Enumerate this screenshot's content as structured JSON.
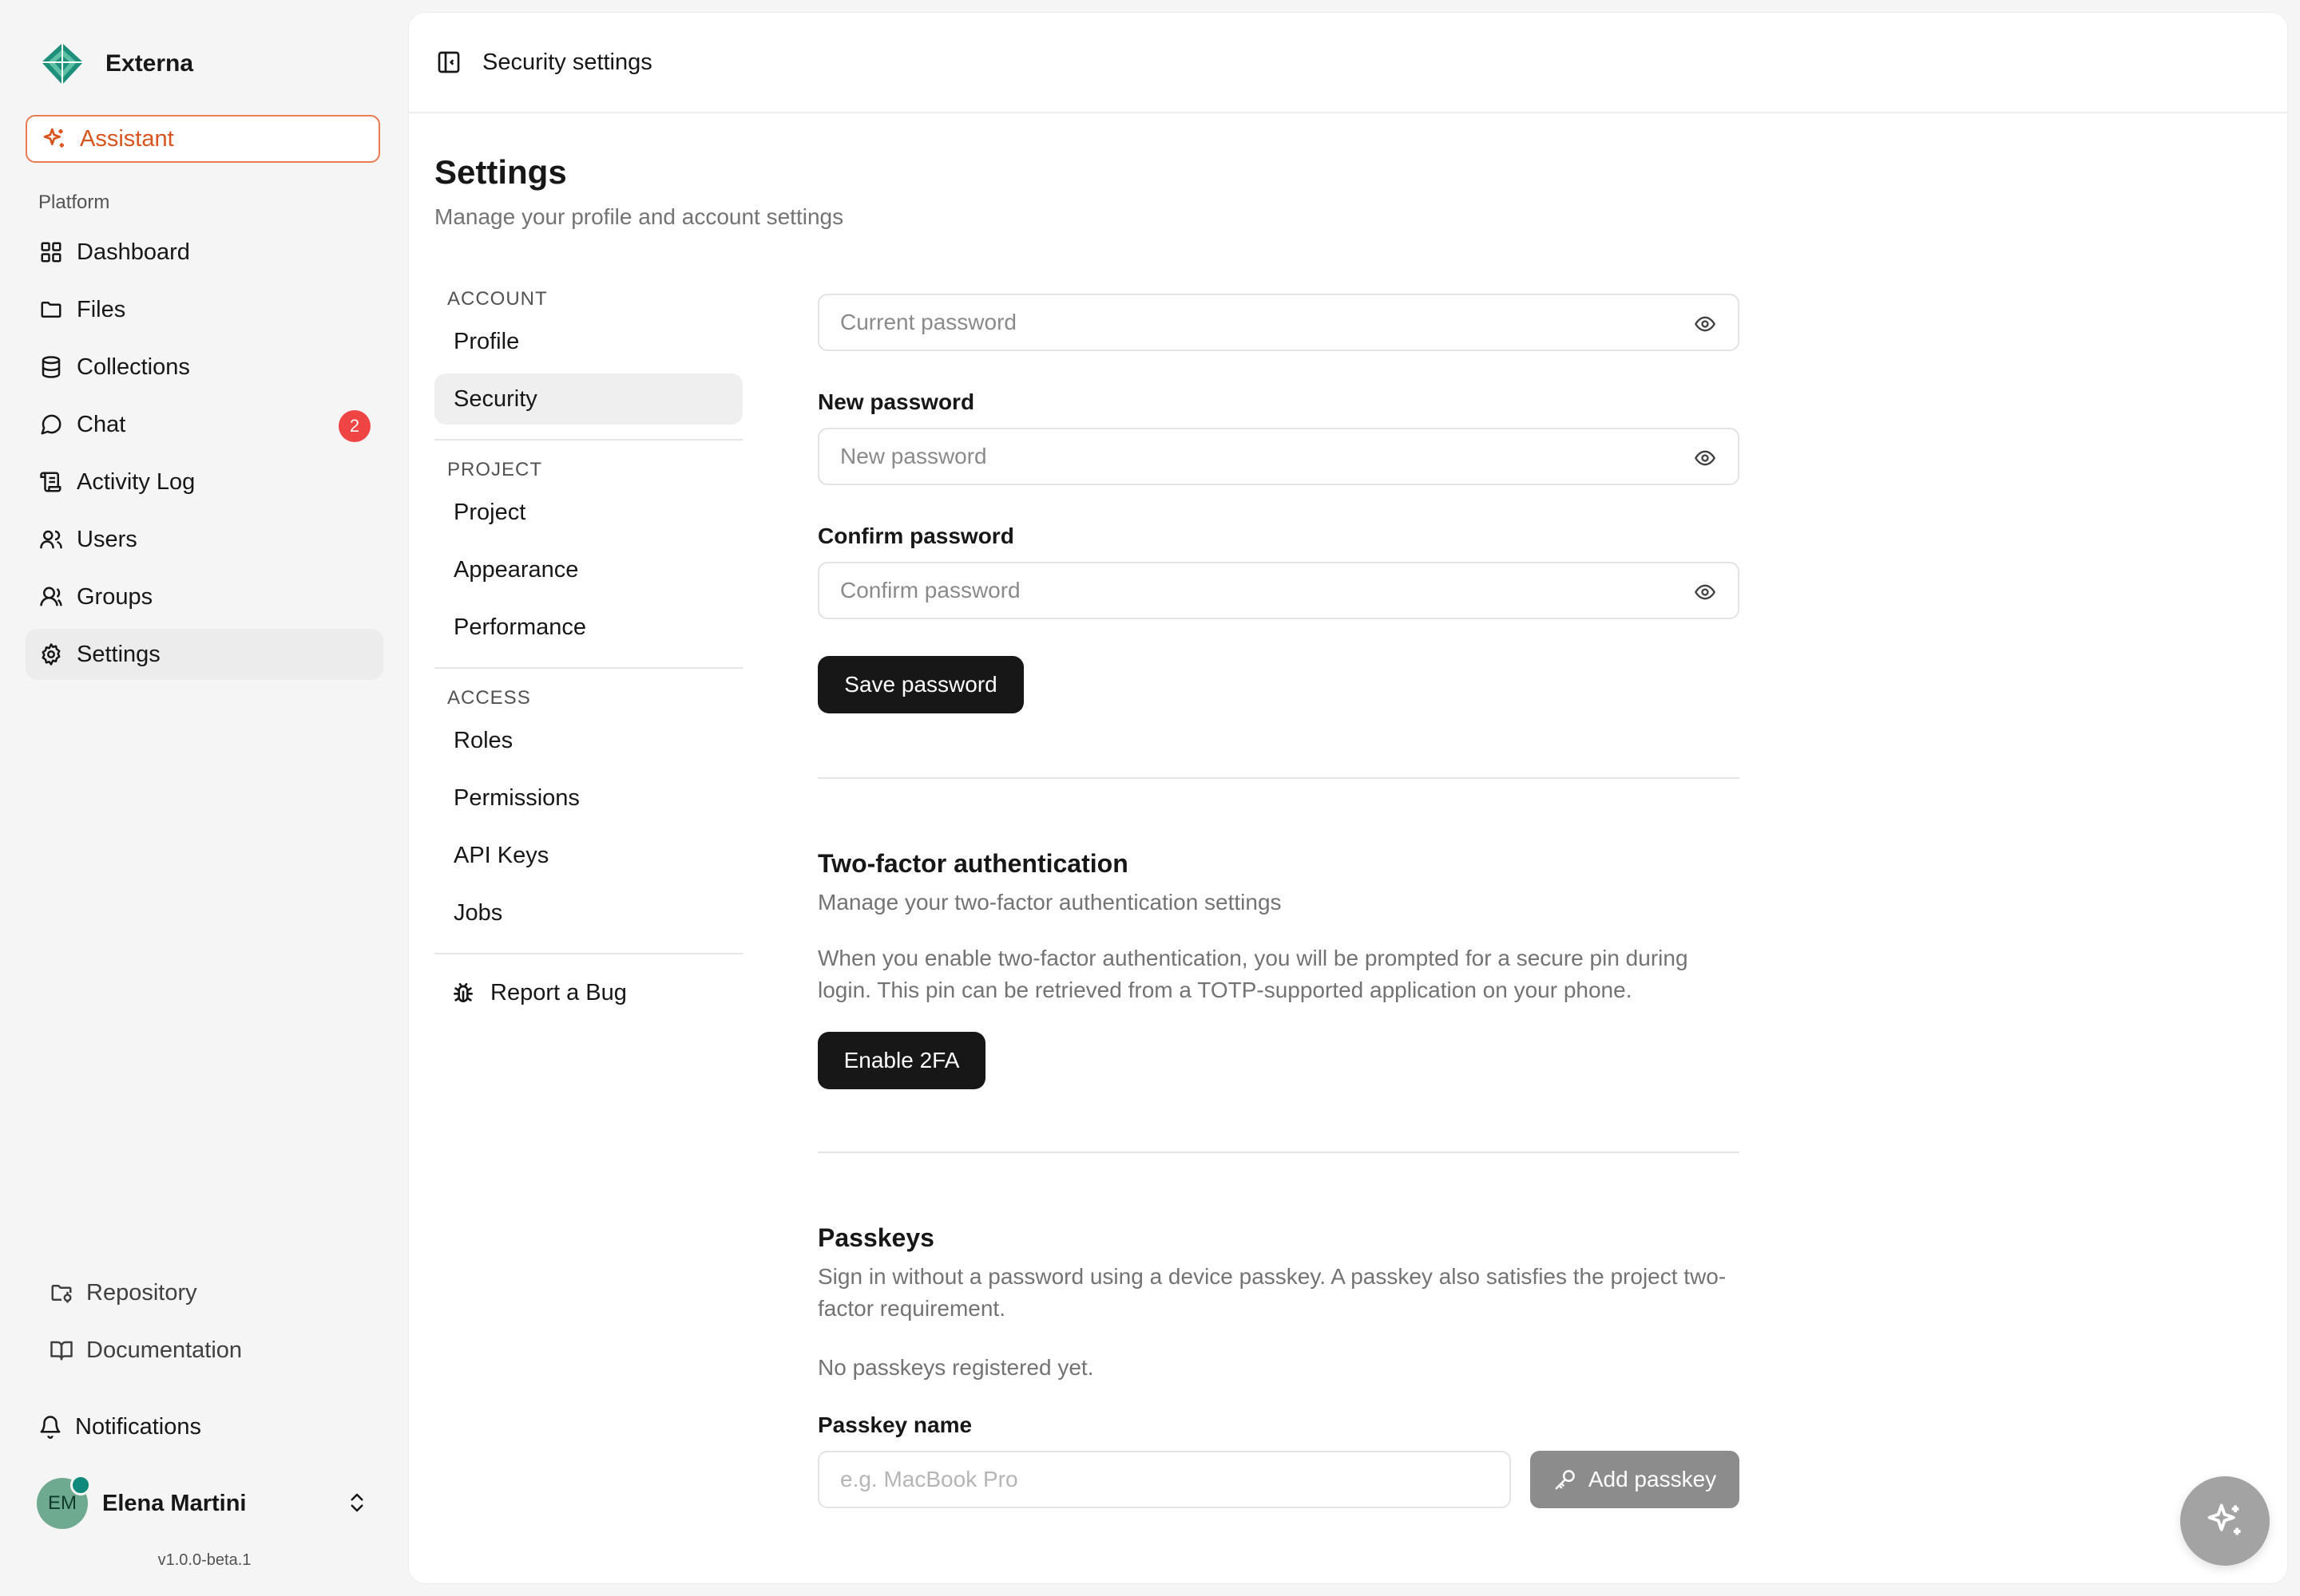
{
  "app": {
    "name": "Externa",
    "version": "v1.0.0-beta.1",
    "accent": "#d9531e"
  },
  "sidebar": {
    "assistant_label": "Assistant",
    "section_label": "Platform",
    "items": [
      {
        "label": "Dashboard",
        "icon": "dashboard-icon"
      },
      {
        "label": "Files",
        "icon": "folder-icon"
      },
      {
        "label": "Collections",
        "icon": "database-icon"
      },
      {
        "label": "Chat",
        "icon": "chat-icon",
        "badge": "2"
      },
      {
        "label": "Activity Log",
        "icon": "scroll-icon"
      },
      {
        "label": "Users",
        "icon": "users-icon"
      },
      {
        "label": "Groups",
        "icon": "user-group-icon"
      },
      {
        "label": "Settings",
        "icon": "gear-icon",
        "active": true
      }
    ],
    "bottom_links": [
      {
        "label": "Repository",
        "icon": "folder-git-icon"
      },
      {
        "label": "Documentation",
        "icon": "book-icon"
      }
    ],
    "notifications_label": "Notifications",
    "user": {
      "initials": "EM",
      "name": "Elena Martini"
    }
  },
  "header": {
    "title": "Security settings"
  },
  "page": {
    "title": "Settings",
    "subtitle": "Manage your profile and account settings"
  },
  "settings_nav": {
    "account_heading": "ACCOUNT",
    "account_items": [
      "Profile",
      "Security"
    ],
    "project_heading": "PROJECT",
    "project_items": [
      "Project",
      "Appearance",
      "Performance"
    ],
    "access_heading": "ACCESS",
    "access_items": [
      "Roles",
      "Permissions",
      "API Keys",
      "Jobs"
    ],
    "report_bug": "Report a Bug",
    "active": "Security"
  },
  "password": {
    "current_placeholder": "Current password",
    "new_label": "New password",
    "new_placeholder": "New password",
    "confirm_label": "Confirm password",
    "confirm_placeholder": "Confirm password",
    "save_label": "Save password"
  },
  "two_factor": {
    "title": "Two-factor authentication",
    "subtitle": "Manage your two-factor authentication settings",
    "body": "When you enable two-factor authentication, you will be prompted for a secure pin during login. This pin can be retrieved from a TOTP-supported application on your phone.",
    "enable_label": "Enable 2FA"
  },
  "passkeys": {
    "title": "Passkeys",
    "subtitle": "Sign in without a password using a device passkey. A passkey also satisfies the project two-factor requirement.",
    "empty": "No passkeys registered yet.",
    "name_label": "Passkey name",
    "name_placeholder": "e.g. MacBook Pro",
    "add_label": "Add passkey"
  }
}
